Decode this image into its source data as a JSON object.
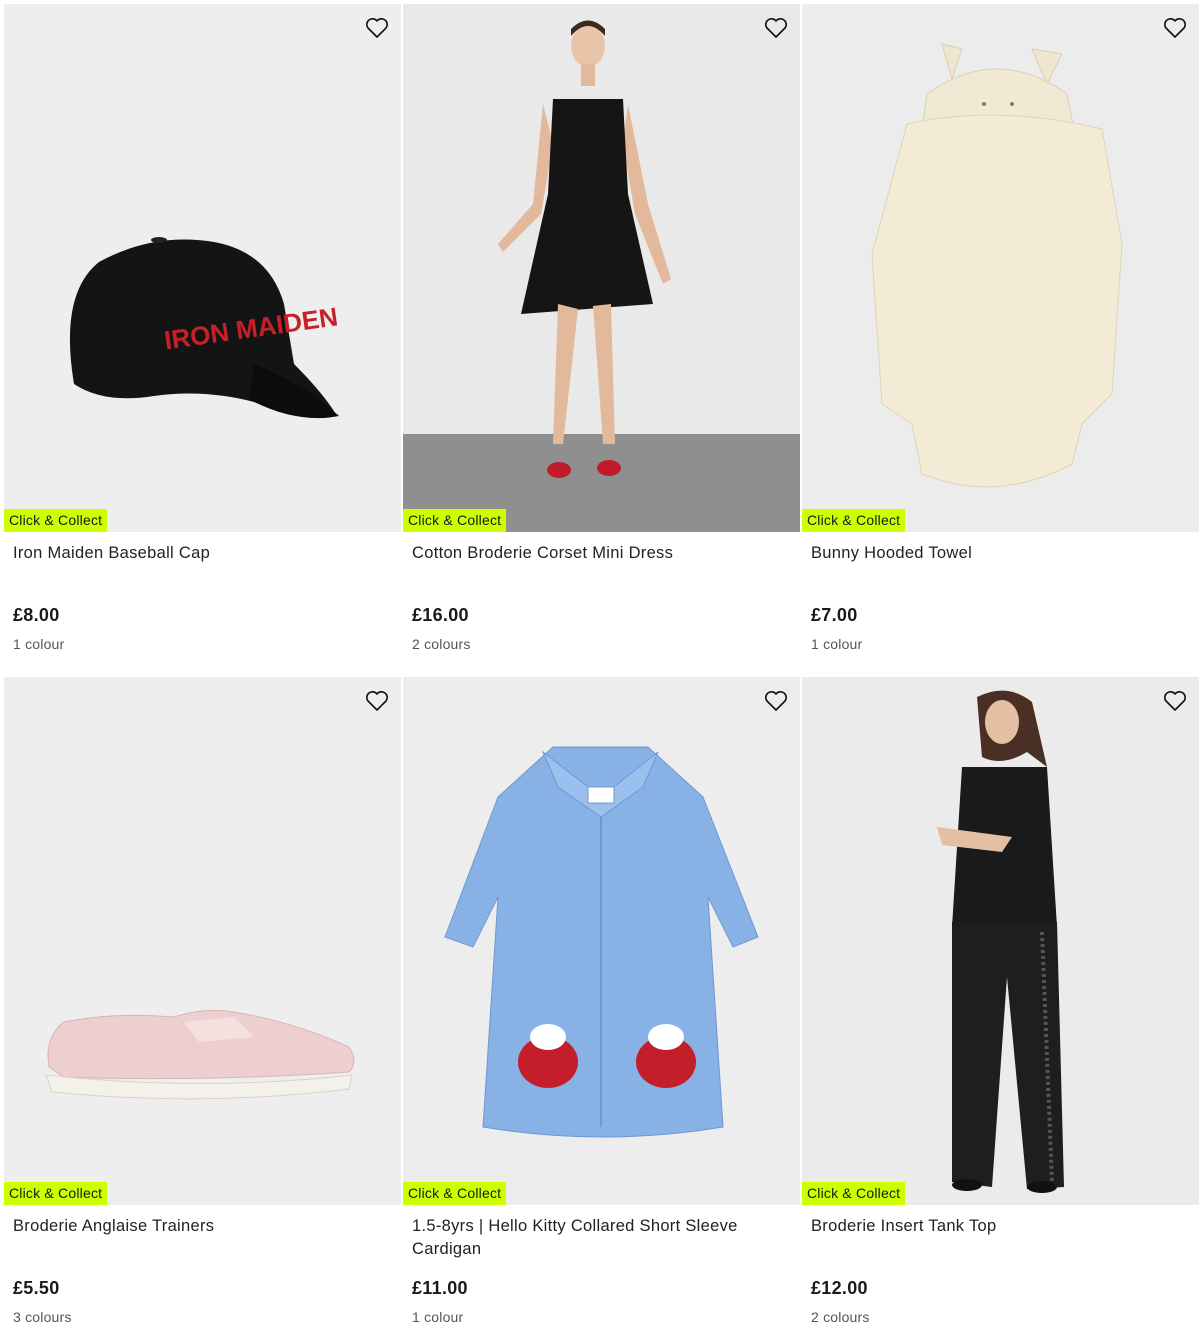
{
  "products": [
    {
      "name": "Iron Maiden Baseball Cap",
      "price": "£8.00",
      "colours": "1 colour",
      "badge": "Click & Collect",
      "wishlist_icon": "heart-outline-icon",
      "cap_print": "IRON MAIDEN"
    },
    {
      "name": "Cotton Broderie Corset Mini Dress",
      "price": "£16.00",
      "colours": "2 colours",
      "badge": "Click & Collect",
      "wishlist_icon": "heart-outline-icon"
    },
    {
      "name": "Bunny Hooded Towel",
      "price": "£7.00",
      "colours": "1 colour",
      "badge": "Click & Collect",
      "wishlist_icon": "heart-outline-icon"
    },
    {
      "name": "Broderie Anglaise Trainers",
      "price": "£5.50",
      "colours": "3 colours",
      "badge": "Click & Collect",
      "wishlist_icon": "heart-outline-icon"
    },
    {
      "name": "1.5-8yrs | Hello Kitty Collared Short Sleeve Cardigan",
      "price": "£11.00",
      "colours": "1 colour",
      "badge": "Click & Collect",
      "wishlist_icon": "heart-outline-icon"
    },
    {
      "name": "Broderie Insert Tank Top",
      "price": "£12.00",
      "colours": "2 colours",
      "badge": "Click & Collect",
      "wishlist_icon": "heart-outline-icon"
    }
  ],
  "colors": {
    "badge_bg": "#ccff00",
    "image_bg": "#efefef"
  }
}
